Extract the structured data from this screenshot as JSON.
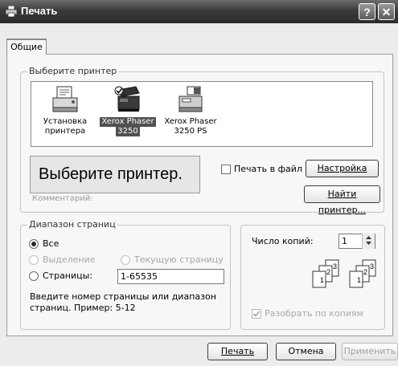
{
  "window": {
    "title": "Печать",
    "help_label": "?",
    "close_label": "✕"
  },
  "tabs": [
    "Общие"
  ],
  "select_printer": {
    "group_label": "Выберите принтер",
    "printers": [
      {
        "label_line1": "Установка",
        "label_line2": "принтера",
        "icon": "add-printer-icon"
      },
      {
        "label_line1": "Xerox Phaser",
        "label_line2": "3250",
        "icon": "printer-icon",
        "selected": true
      },
      {
        "label_line1": "Xerox Phaser",
        "label_line2": "3250 PS",
        "icon": "printer-icon"
      }
    ],
    "callout": "Выберите принтер.",
    "hidden_text": "Комментарий:",
    "print_to_file_label": "Печать в файл",
    "preferences_button": "Настройка",
    "find_printer_button": "Найти принтер..."
  },
  "page_range": {
    "group_label": "Диапазон страниц",
    "all_label": "Все",
    "selection_label": "Выделение",
    "current_page_label": "Текущую страницу",
    "pages_label": "Страницы:",
    "pages_value": "1-65535",
    "hint_line1": "Введите номер страницы или диапазон",
    "hint_line2": "страниц.  Пример: 5-12"
  },
  "copies": {
    "count_label": "Число копий:",
    "count_value": "1",
    "collate_label": "Разобрать по копиям"
  },
  "footer": {
    "print_button": "Печать",
    "cancel_button": "Отмена",
    "apply_button": "Применить"
  }
}
